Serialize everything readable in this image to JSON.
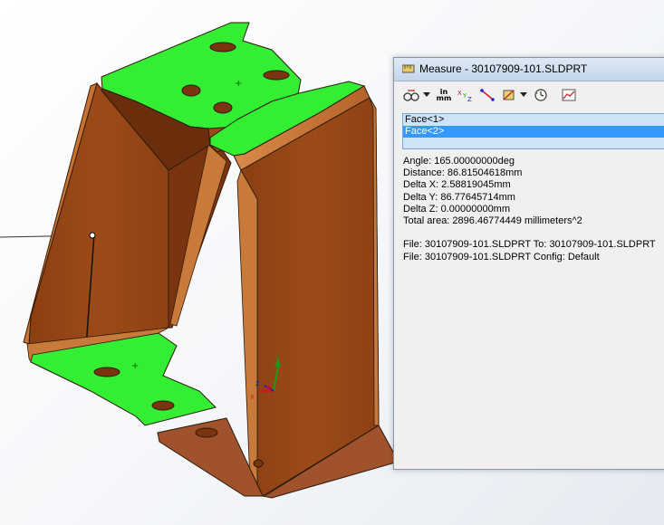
{
  "dialog": {
    "title": "Measure - 30107909-101.SLDPRT",
    "toolbar": {
      "arc_circle_icon": "arc-circle-measure-icon",
      "units_top": "in",
      "units_bottom": "mm",
      "xyz_icon": "xyz-measure-icon",
      "point_to_point_icon": "point-to-point-icon",
      "projection_icon": "projection-icon",
      "history_icon": "measure-history-icon",
      "sensor_icon": "create-sensor-icon"
    },
    "selection_list": {
      "items": [
        "Face<1>",
        "Face<2>"
      ],
      "selected_index": 1
    },
    "results": {
      "angle": "Angle: 165.00000000deg",
      "distance": "Distance: 86.81504618mm",
      "delta_x": "Delta X: 2.58819045mm",
      "delta_y": "Delta Y: 86.77645714mm",
      "delta_z": "Delta Z: 0.00000000mm",
      "total_area": "Total area: 2896.46774449 millimeters^2",
      "file_to": "File: 30107909-101.SLDPRT To: 30107909-101.SLDPRT",
      "file_config": "File: 30107909-101.SLDPRT Config: Default"
    }
  },
  "viewport": {
    "axis_triad": {
      "x": "X",
      "y": "Y",
      "z": "Z"
    },
    "part_color": "#a0522d",
    "selected_face_color": "#22ee22",
    "arrow_color": "#1a7a1a"
  }
}
